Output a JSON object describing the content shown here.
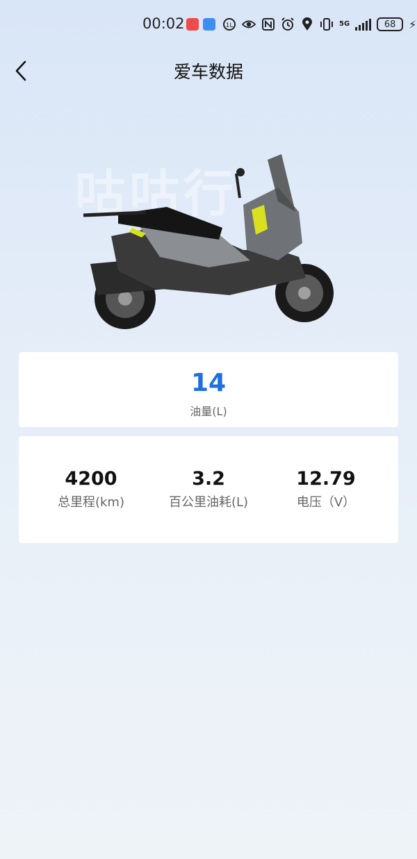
{
  "status_bar": {
    "time": "00:02",
    "network": "5G",
    "battery": "68"
  },
  "header": {
    "title": "爱车数据"
  },
  "hero": {
    "watermark": "咕咕行"
  },
  "fuel": {
    "value": "14",
    "label": "油量(L)",
    "value_color": "#1f6fe0"
  },
  "stats": [
    {
      "value": "4200",
      "label": "总里程(km)"
    },
    {
      "value": "3.2",
      "label": "百公里油耗(L)"
    },
    {
      "value": "12.79",
      "label": "电压（V）"
    }
  ]
}
